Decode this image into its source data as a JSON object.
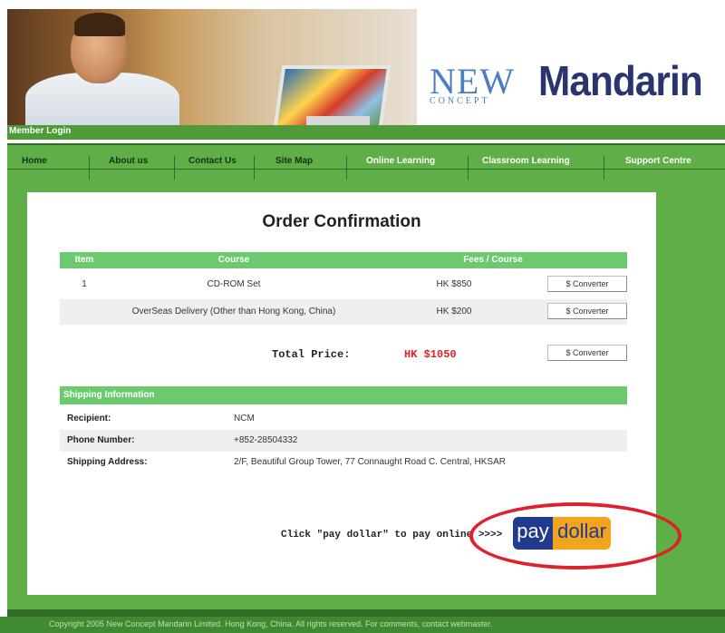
{
  "header": {
    "logo_new": "NEW",
    "logo_concept": "CONCEPT",
    "logo_mandarin": "Mandarin",
    "member_login": "Member Login"
  },
  "nav": {
    "items": [
      {
        "label": "Home"
      },
      {
        "label": "About us"
      },
      {
        "label": "Contact Us"
      },
      {
        "label": "Site Map"
      },
      {
        "label": "Online Learning"
      },
      {
        "label": "Classroom Learning"
      },
      {
        "label": "Support Centre"
      }
    ]
  },
  "order": {
    "title": "Order Confirmation",
    "columns": [
      "Item",
      "Course",
      "Fees / Course"
    ],
    "rows": [
      {
        "item": "1",
        "course": "CD-ROM Set",
        "fee": "HK $850",
        "button": "$ Converter"
      },
      {
        "item": "",
        "course": "OverSeas Delivery (Other than Hong Kong, China)",
        "fee": "HK $200",
        "button": "$ Converter"
      }
    ],
    "total_label": "Total Price:",
    "total_value": "HK $1050",
    "total_button": "$ Converter"
  },
  "shipping": {
    "header": "Shipping Information",
    "rows": [
      {
        "label": "Recipient:",
        "value": "NCM"
      },
      {
        "label": "Phone Number:",
        "value": "+852-28504332"
      },
      {
        "label": "Shipping Address:",
        "value": "2/F, Beautiful Group Tower, 77 Connaught Road C. Central, HKSAR"
      }
    ]
  },
  "pay": {
    "instruction": "Click \"pay dollar\" to pay online >>>>",
    "logo_pay": "pay",
    "logo_dollar": "dollar",
    "highlight_color": "#e0202a"
  },
  "footer": {
    "text": "Copyright 2005 New Concept Mandarin Limited. Hong Kong, China. All rights reserved. For comments, contact webmaster."
  },
  "colors": {
    "brand_green": "#5fae48",
    "table_header_green": "#6cc96f",
    "price_red": "#e0202a"
  }
}
